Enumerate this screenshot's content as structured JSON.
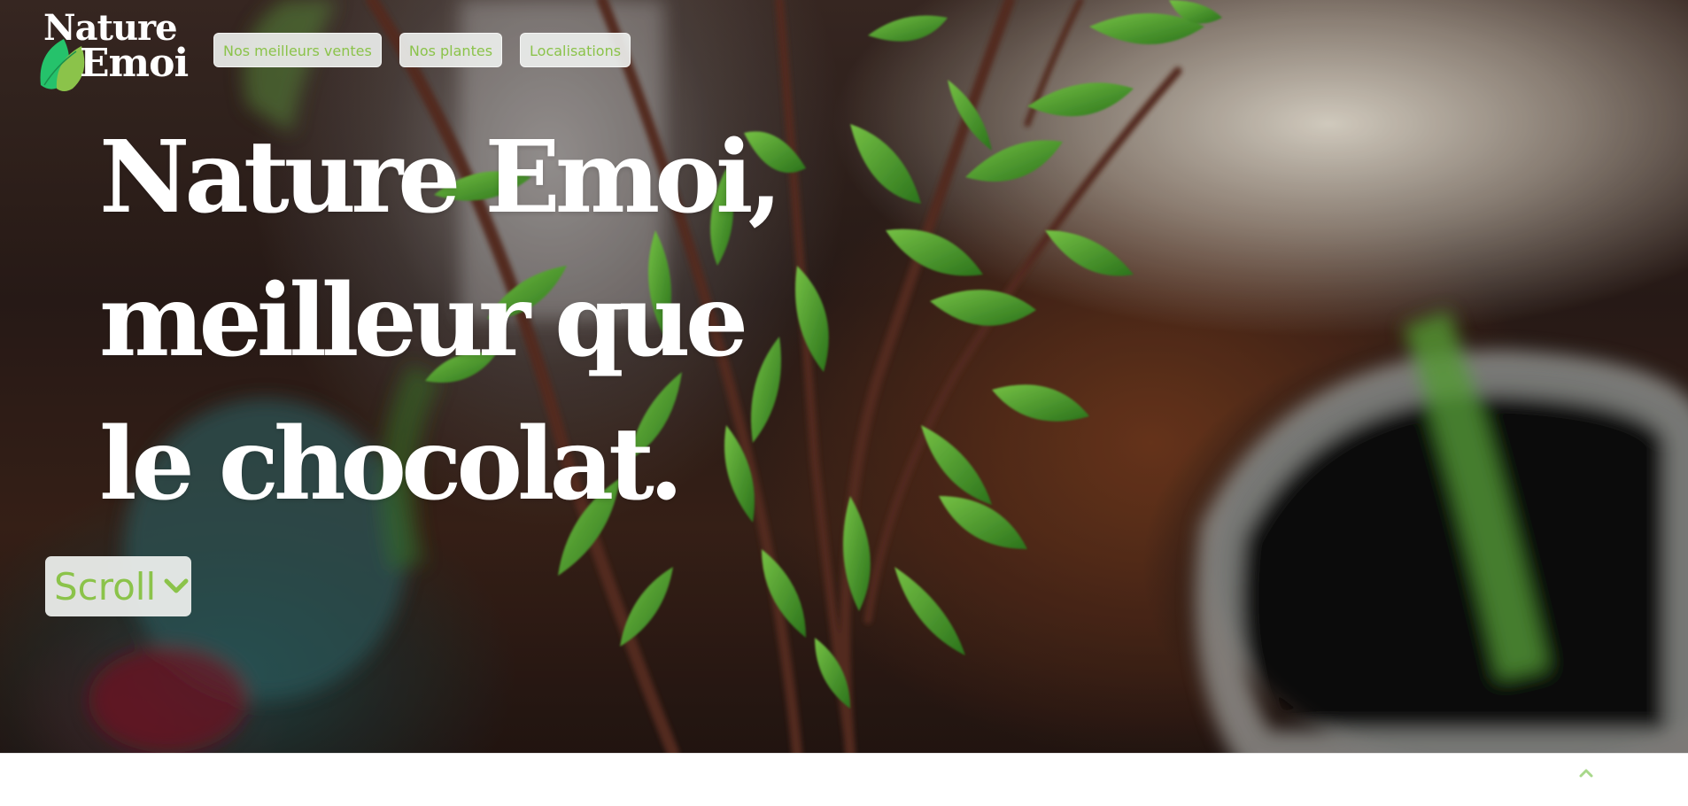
{
  "brand": {
    "line1": "Nature",
    "line2": "Emoi",
    "leaf_colors": [
      "#2ecc71",
      "#8bc34a"
    ]
  },
  "nav": {
    "items": [
      {
        "label": "Nos meilleurs ventes"
      },
      {
        "label": "Nos plantes"
      },
      {
        "label": "Localisations"
      }
    ]
  },
  "hero": {
    "headline_lines": [
      "Nature Emoi,",
      "meilleur que",
      "le chocolat."
    ],
    "scroll_label": "Scroll",
    "scroll_icon": "chevron-down-icon"
  },
  "footer": {
    "back_to_top_icon": "chevron-up-icon"
  },
  "colors": {
    "accent": "#8bc34a",
    "button_bg": "#eceeec",
    "text_light": "#ffffff"
  }
}
